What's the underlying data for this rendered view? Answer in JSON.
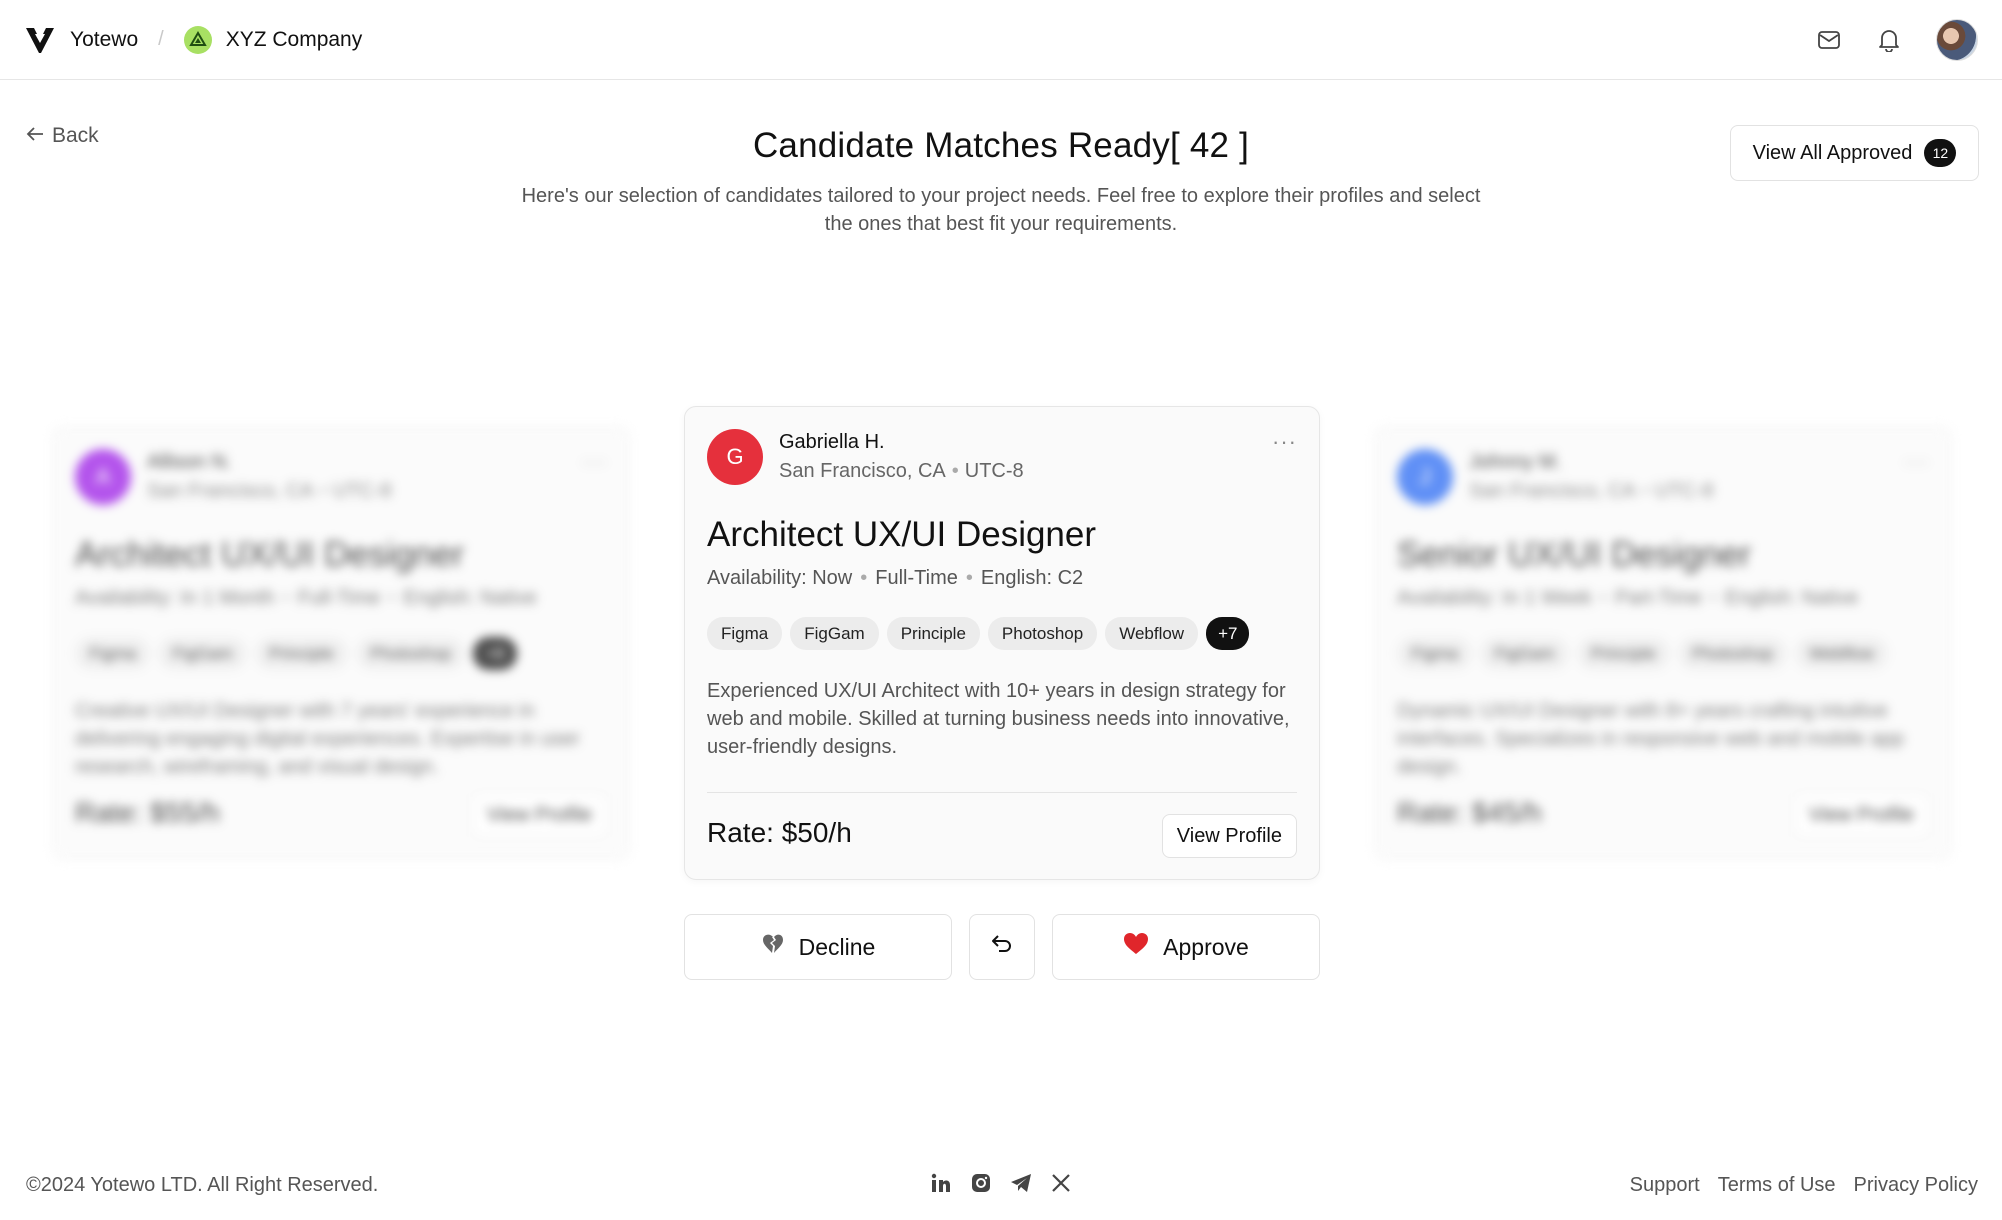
{
  "topbar": {
    "brand_name": "Yotewo",
    "separator": "/",
    "company_name": "XYZ Company",
    "icons": [
      "brand-logo-icon",
      "company-logo-icon",
      "mail-icon",
      "bell-icon",
      "avatar"
    ]
  },
  "header": {
    "back_label": "Back",
    "title": "Candidate Matches Ready",
    "count": "[ 42 ]",
    "subtitle": "Here's our selection of candidates tailored to your project needs. Feel free to explore their profiles and select the ones that best fit your requirements.",
    "view_approved_label": "View All Approved",
    "approved_count": "12"
  },
  "cards": {
    "left": {
      "initial": "A",
      "avatar_color": "#9b1be6",
      "name": "Allison N.",
      "location": "San Francisco, CA",
      "timezone": "UTC-8",
      "role": "Architect UX/UI Designer",
      "availability": "Availability: In 1 Month",
      "type": "Full-Time",
      "english": "English: Native",
      "tags": [
        "Figma",
        "FigGam",
        "Principle",
        "Photoshop"
      ],
      "more_tags": "+8",
      "description": "Creative UX/UI Designer with 7 years' experience in delivering engaging digital experiences. Expertise in user research, wireframing, and visual design.",
      "rate": "Rate: $55/h",
      "view_profile_label": "View Profile"
    },
    "center": {
      "initial": "G",
      "avatar_color": "#e5303c",
      "name": "Gabriella H.",
      "location": "San Francisco, CA",
      "timezone": "UTC-8",
      "role": "Architect UX/UI Designer",
      "availability": "Availability: Now",
      "type": "Full-Time",
      "english": "English: C2",
      "tags": [
        "Figma",
        "FigGam",
        "Principle",
        "Photoshop",
        "Webflow"
      ],
      "more_tags": "+7",
      "description": "Experienced UX/UI Architect with 10+ years in design strategy for web and mobile. Skilled at turning business needs into innovative, user-friendly designs.",
      "rate": "Rate: $50/h",
      "view_profile_label": "View Profile"
    },
    "right": {
      "initial": "J",
      "avatar_color": "#2b6bf3",
      "name": "Johnny M.",
      "location": "San Francisco, CA",
      "timezone": "UTC-8",
      "role": "Senior UX/UI Designer",
      "availability": "Availability: In 1 Week",
      "type": "Part-Time",
      "english": "English: Native",
      "tags": [
        "Figma",
        "FigGam",
        "Principle",
        "Photoshop",
        "Webflow"
      ],
      "description": "Dynamic UX/UI Designer with 8+ years crafting intuitive interfaces. Specializes in responsive web and mobile app design.",
      "rate": "Rate: $45/h",
      "view_profile_label": "View Profile"
    }
  },
  "actions": {
    "decline_label": "Decline",
    "approve_label": "Approve",
    "undo_icon": "undo-icon",
    "decline_icon": "broken-heart-icon",
    "approve_icon": "heart-icon",
    "approve_color": "#e0262b"
  },
  "footer": {
    "copyright": "©2024 Yotewo LTD. All Right Reserved.",
    "socials": [
      "linkedin-icon",
      "instagram-icon",
      "telegram-icon",
      "x-icon"
    ],
    "links": [
      "Support",
      "Terms of Use",
      "Privacy Policy"
    ]
  }
}
